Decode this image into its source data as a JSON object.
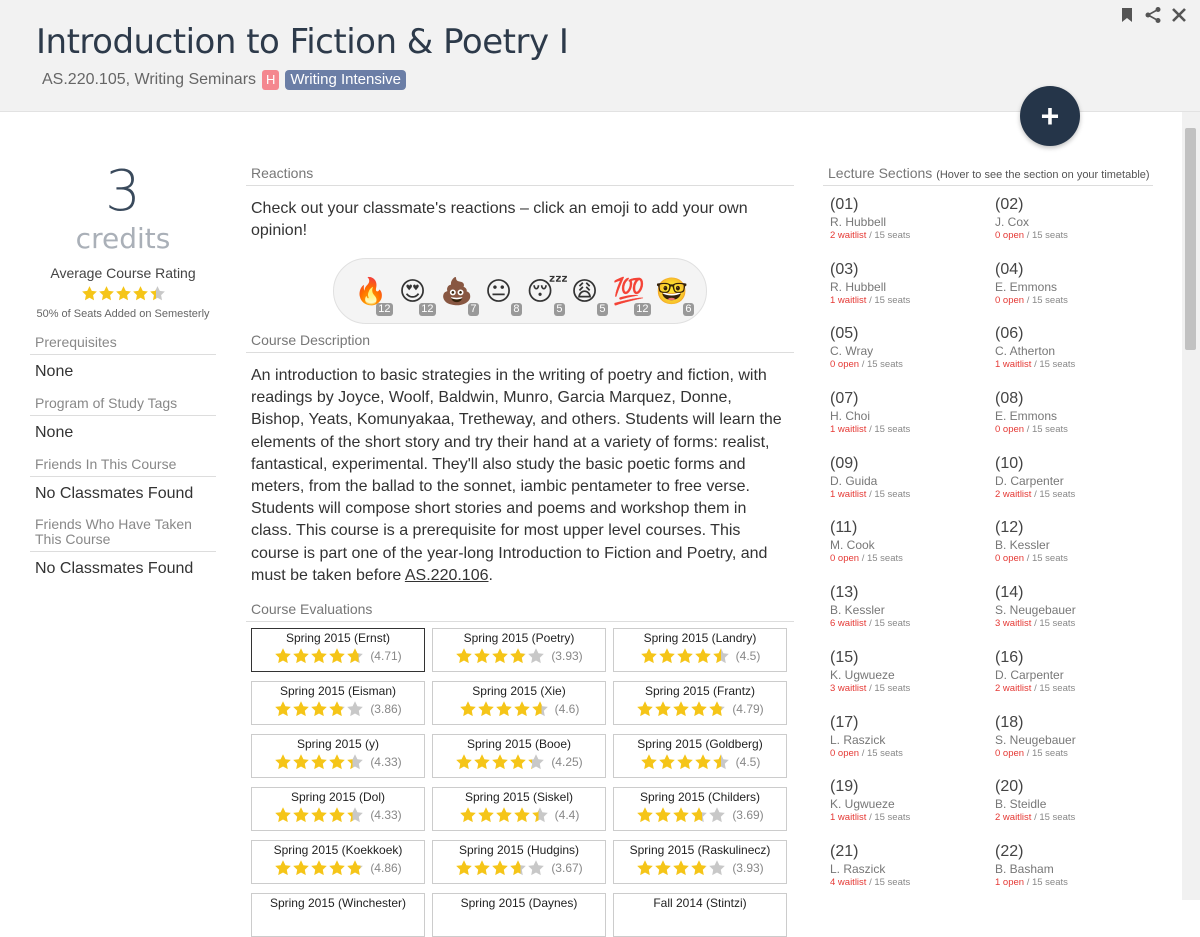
{
  "header": {
    "title": "Introduction to Fiction & Poetry I",
    "course_code": "AS.220.105, Writing Seminars",
    "area_badge": "H",
    "tag_badge": "Writing Intensive",
    "icons": [
      "bookmark-icon",
      "share-icon",
      "close-icon"
    ],
    "add_button": "+"
  },
  "left": {
    "credits": "3",
    "credits_label": "credits",
    "avg_rating_label": "Average Course Rating",
    "avg_rating": 4.4,
    "seats_note": "50% of Seats Added on Semesterly",
    "prereq_head": "Prerequisites",
    "prereq_val": "None",
    "pos_head": "Program of Study Tags",
    "pos_val": "None",
    "friends_head": "Friends In This Course",
    "friends_val": "No Classmates Found",
    "friends_taken_head": "Friends Who Have Taken This Course",
    "friends_taken_val": "No Classmates Found"
  },
  "reactions": {
    "heading": "Reactions",
    "text": "Check out your classmate's reactions – click an emoji to add your own opinion!",
    "items": [
      {
        "name": "fire-emoji",
        "glyph": "🔥",
        "count": "12"
      },
      {
        "name": "heart-eyes-emoji",
        "glyph": "😍",
        "count": "12"
      },
      {
        "name": "poop-emoji",
        "glyph": "💩",
        "count": "7"
      },
      {
        "name": "neutral-face-emoji",
        "glyph": "😐",
        "count": "8"
      },
      {
        "name": "sleeping-emoji",
        "glyph": "😴",
        "count": "5"
      },
      {
        "name": "weary-emoji",
        "glyph": "😩",
        "count": "5"
      },
      {
        "name": "hundred-emoji",
        "glyph": "💯",
        "count": "12"
      },
      {
        "name": "nerd-emoji",
        "glyph": "🤓",
        "count": "6"
      }
    ]
  },
  "description": {
    "heading": "Course Description",
    "text": "An introduction to basic strategies in the writing of poetry and fiction, with readings by Joyce, Woolf, Baldwin, Munro, Garcia Marquez, Donne, Bishop, Yeats, Komunyakaa, Tretheway, and others. Students will learn the elements of the short story and try their hand at a variety of forms: realist, fantastical, experimental. They'll also study the basic poetic forms and meters, from the ballad to the sonnet, iambic pentameter to free verse. Students will compose short stories and poems and workshop them in class. This course is a prerequisite for most upper level courses. This course is part one of the year-long Introduction to Fiction and Poetry, and must be taken before ",
    "link": "AS.220.106",
    "after_link": "."
  },
  "evaluations": {
    "heading": "Course Evaluations",
    "items": [
      {
        "term": "Spring 2015 (Ernst)",
        "score": "(4.71)",
        "rating": 4.71
      },
      {
        "term": "Spring 2015 (Poetry)",
        "score": "(3.93)",
        "rating": 3.93
      },
      {
        "term": "Spring 2015 (Landry)",
        "score": "(4.5)",
        "rating": 4.5
      },
      {
        "term": "Spring 2015 (Eisman)",
        "score": "(3.86)",
        "rating": 3.86
      },
      {
        "term": "Spring 2015 (Xie)",
        "score": "(4.6)",
        "rating": 4.6
      },
      {
        "term": "Spring 2015 (Frantz)",
        "score": "(4.79)",
        "rating": 4.79
      },
      {
        "term": "Spring 2015 (y)",
        "score": "(4.33)",
        "rating": 4.33
      },
      {
        "term": "Spring 2015 (Booe)",
        "score": "(4.25)",
        "rating": 4.25
      },
      {
        "term": "Spring 2015 (Goldberg)",
        "score": "(4.5)",
        "rating": 4.5
      },
      {
        "term": "Spring 2015 (Dol)",
        "score": "(4.33)",
        "rating": 4.33
      },
      {
        "term": "Spring 2015 (Siskel)",
        "score": "(4.4)",
        "rating": 4.4
      },
      {
        "term": "Spring 2015 (Childers)",
        "score": "(3.69)",
        "rating": 3.69
      },
      {
        "term": "Spring 2015 (Koekkoek)",
        "score": "(4.86)",
        "rating": 4.86
      },
      {
        "term": "Spring 2015 (Hudgins)",
        "score": "(3.67)",
        "rating": 3.67
      },
      {
        "term": "Spring 2015 (Raskulinecz)",
        "score": "(3.93)",
        "rating": 3.93
      },
      {
        "term": "Spring 2015 (Winchester)",
        "score": "",
        "rating": 0
      },
      {
        "term": "Spring 2015 (Daynes)",
        "score": "",
        "rating": 0
      },
      {
        "term": "Fall 2014 (Stintzi)",
        "score": "",
        "rating": 0
      }
    ]
  },
  "lecture": {
    "heading": "Lecture Sections",
    "hint": "(Hover to see the section on your timetable)",
    "sections": [
      {
        "num": "(01)",
        "inst": "R. Hubbell",
        "avail": "2 waitlist",
        "seats": " / 15 seats"
      },
      {
        "num": "(02)",
        "inst": "J. Cox",
        "avail": "0 open",
        "seats": " / 15 seats"
      },
      {
        "num": "(03)",
        "inst": "R. Hubbell",
        "avail": "1 waitlist",
        "seats": " / 15 seats"
      },
      {
        "num": "(04)",
        "inst": "E. Emmons",
        "avail": "0 open",
        "seats": " / 15 seats"
      },
      {
        "num": "(05)",
        "inst": "C. Wray",
        "avail": "0 open",
        "seats": " / 15 seats"
      },
      {
        "num": "(06)",
        "inst": "C. Atherton",
        "avail": "1 waitlist",
        "seats": " / 15 seats"
      },
      {
        "num": "(07)",
        "inst": "H. Choi",
        "avail": "1 waitlist",
        "seats": " / 15 seats"
      },
      {
        "num": "(08)",
        "inst": "E. Emmons",
        "avail": "0 open",
        "seats": " / 15 seats"
      },
      {
        "num": "(09)",
        "inst": "D. Guida",
        "avail": "1 waitlist",
        "seats": " / 15 seats"
      },
      {
        "num": "(10)",
        "inst": "D. Carpenter",
        "avail": "2 waitlist",
        "seats": " / 15 seats"
      },
      {
        "num": "(11)",
        "inst": "M. Cook",
        "avail": "0 open",
        "seats": " / 15 seats"
      },
      {
        "num": "(12)",
        "inst": "B. Kessler",
        "avail": "0 open",
        "seats": " / 15 seats"
      },
      {
        "num": "(13)",
        "inst": "B. Kessler",
        "avail": "6 waitlist",
        "seats": " / 15 seats"
      },
      {
        "num": "(14)",
        "inst": "S. Neugebauer",
        "avail": "3 waitlist",
        "seats": " / 15 seats"
      },
      {
        "num": "(15)",
        "inst": "K. Ugwueze",
        "avail": "3 waitlist",
        "seats": " / 15 seats"
      },
      {
        "num": "(16)",
        "inst": "D. Carpenter",
        "avail": "2 waitlist",
        "seats": " / 15 seats"
      },
      {
        "num": "(17)",
        "inst": "L. Raszick",
        "avail": "0 open",
        "seats": " / 15 seats"
      },
      {
        "num": "(18)",
        "inst": "S. Neugebauer",
        "avail": "0 open",
        "seats": " / 15 seats"
      },
      {
        "num": "(19)",
        "inst": "K. Ugwueze",
        "avail": "1 waitlist",
        "seats": " / 15 seats"
      },
      {
        "num": "(20)",
        "inst": "B. Steidle",
        "avail": "2 waitlist",
        "seats": " / 15 seats"
      },
      {
        "num": "(21)",
        "inst": "L. Raszick",
        "avail": "4 waitlist",
        "seats": " / 15 seats"
      },
      {
        "num": "(22)",
        "inst": "B. Basham",
        "avail": "1 open",
        "seats": " / 15 seats"
      }
    ]
  },
  "colors": {
    "star": "#f5c518",
    "star_empty": "#c8c8c8",
    "accent_dark": "#253549",
    "red": "#e53935"
  }
}
